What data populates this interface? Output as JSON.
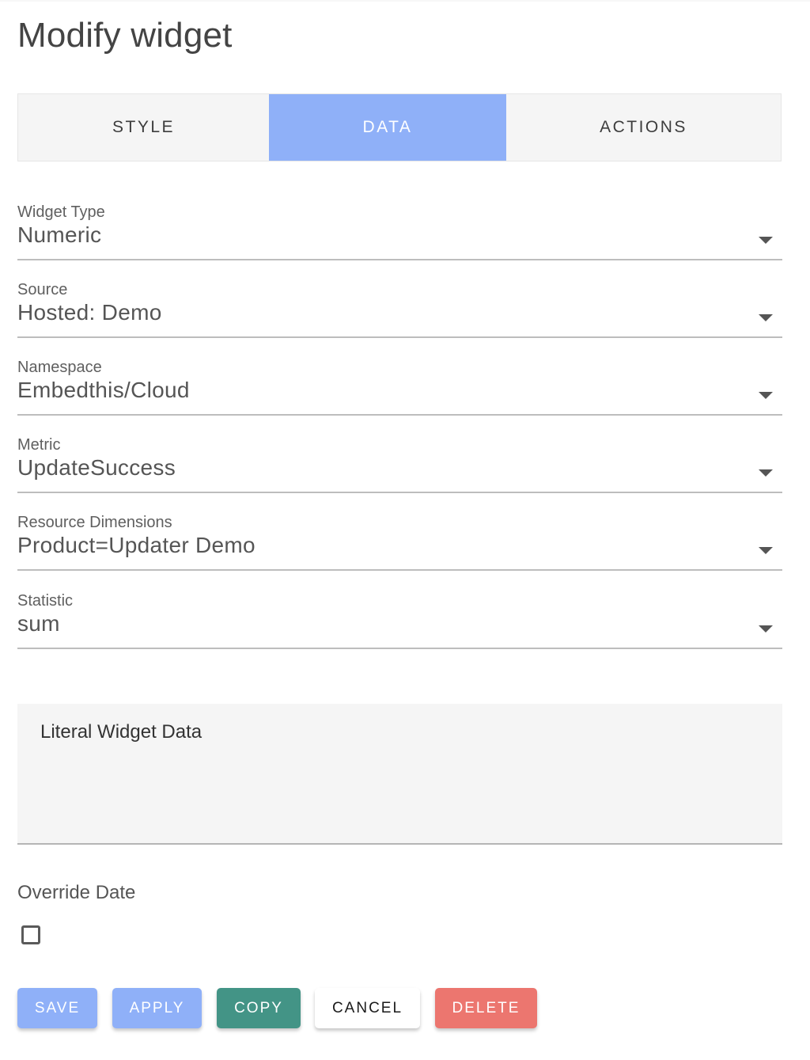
{
  "dialog": {
    "title": "Modify widget"
  },
  "tabs": [
    {
      "label": "STYLE",
      "active": false
    },
    {
      "label": "DATA",
      "active": true
    },
    {
      "label": "ACTIONS",
      "active": false
    }
  ],
  "fields": [
    {
      "label": "Widget Type",
      "value": "Numeric"
    },
    {
      "label": "Source",
      "value": "Hosted: Demo"
    },
    {
      "label": "Namespace",
      "value": "Embedthis/Cloud"
    },
    {
      "label": "Metric",
      "value": "UpdateSuccess"
    },
    {
      "label": "Resource Dimensions",
      "value": "Product=Updater Demo"
    },
    {
      "label": "Statistic",
      "value": "sum"
    }
  ],
  "literal": {
    "label": "Literal Widget Data",
    "value": ""
  },
  "override_date": {
    "label": "Override Date",
    "checked": false
  },
  "buttons": {
    "save": "SAVE",
    "apply": "APPLY",
    "copy": "COPY",
    "cancel": "CANCEL",
    "delete": "DELETE"
  },
  "colors": {
    "accent": "#8fb0f8",
    "copy": "#439486",
    "delete": "#ec766f"
  }
}
